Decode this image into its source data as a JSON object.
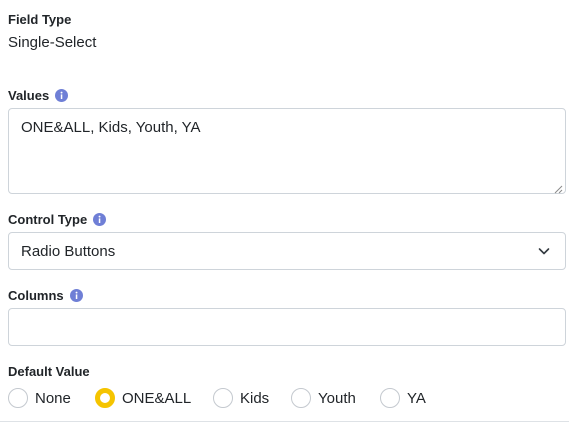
{
  "field_type": {
    "label": "Field Type",
    "value": "Single-Select"
  },
  "values": {
    "label": "Values",
    "icon": "info-icon",
    "text": "ONE&ALL, Kids, Youth, YA"
  },
  "control_type": {
    "label": "Control Type",
    "icon": "info-icon",
    "selected": "Radio Buttons",
    "dropdown_icon": "chevron-down-icon"
  },
  "columns": {
    "label": "Columns",
    "icon": "info-icon",
    "value": ""
  },
  "default_value": {
    "label": "Default Value",
    "options": [
      {
        "label": "None",
        "checked": false
      },
      {
        "label": "ONE&ALL",
        "checked": true
      },
      {
        "label": "Kids",
        "checked": false
      },
      {
        "label": "Youth",
        "checked": false
      },
      {
        "label": "YA",
        "checked": false
      }
    ]
  },
  "colors": {
    "info_icon": "#6f7fd6",
    "radio_checked": "#f5c400",
    "border": "#ced4da"
  }
}
